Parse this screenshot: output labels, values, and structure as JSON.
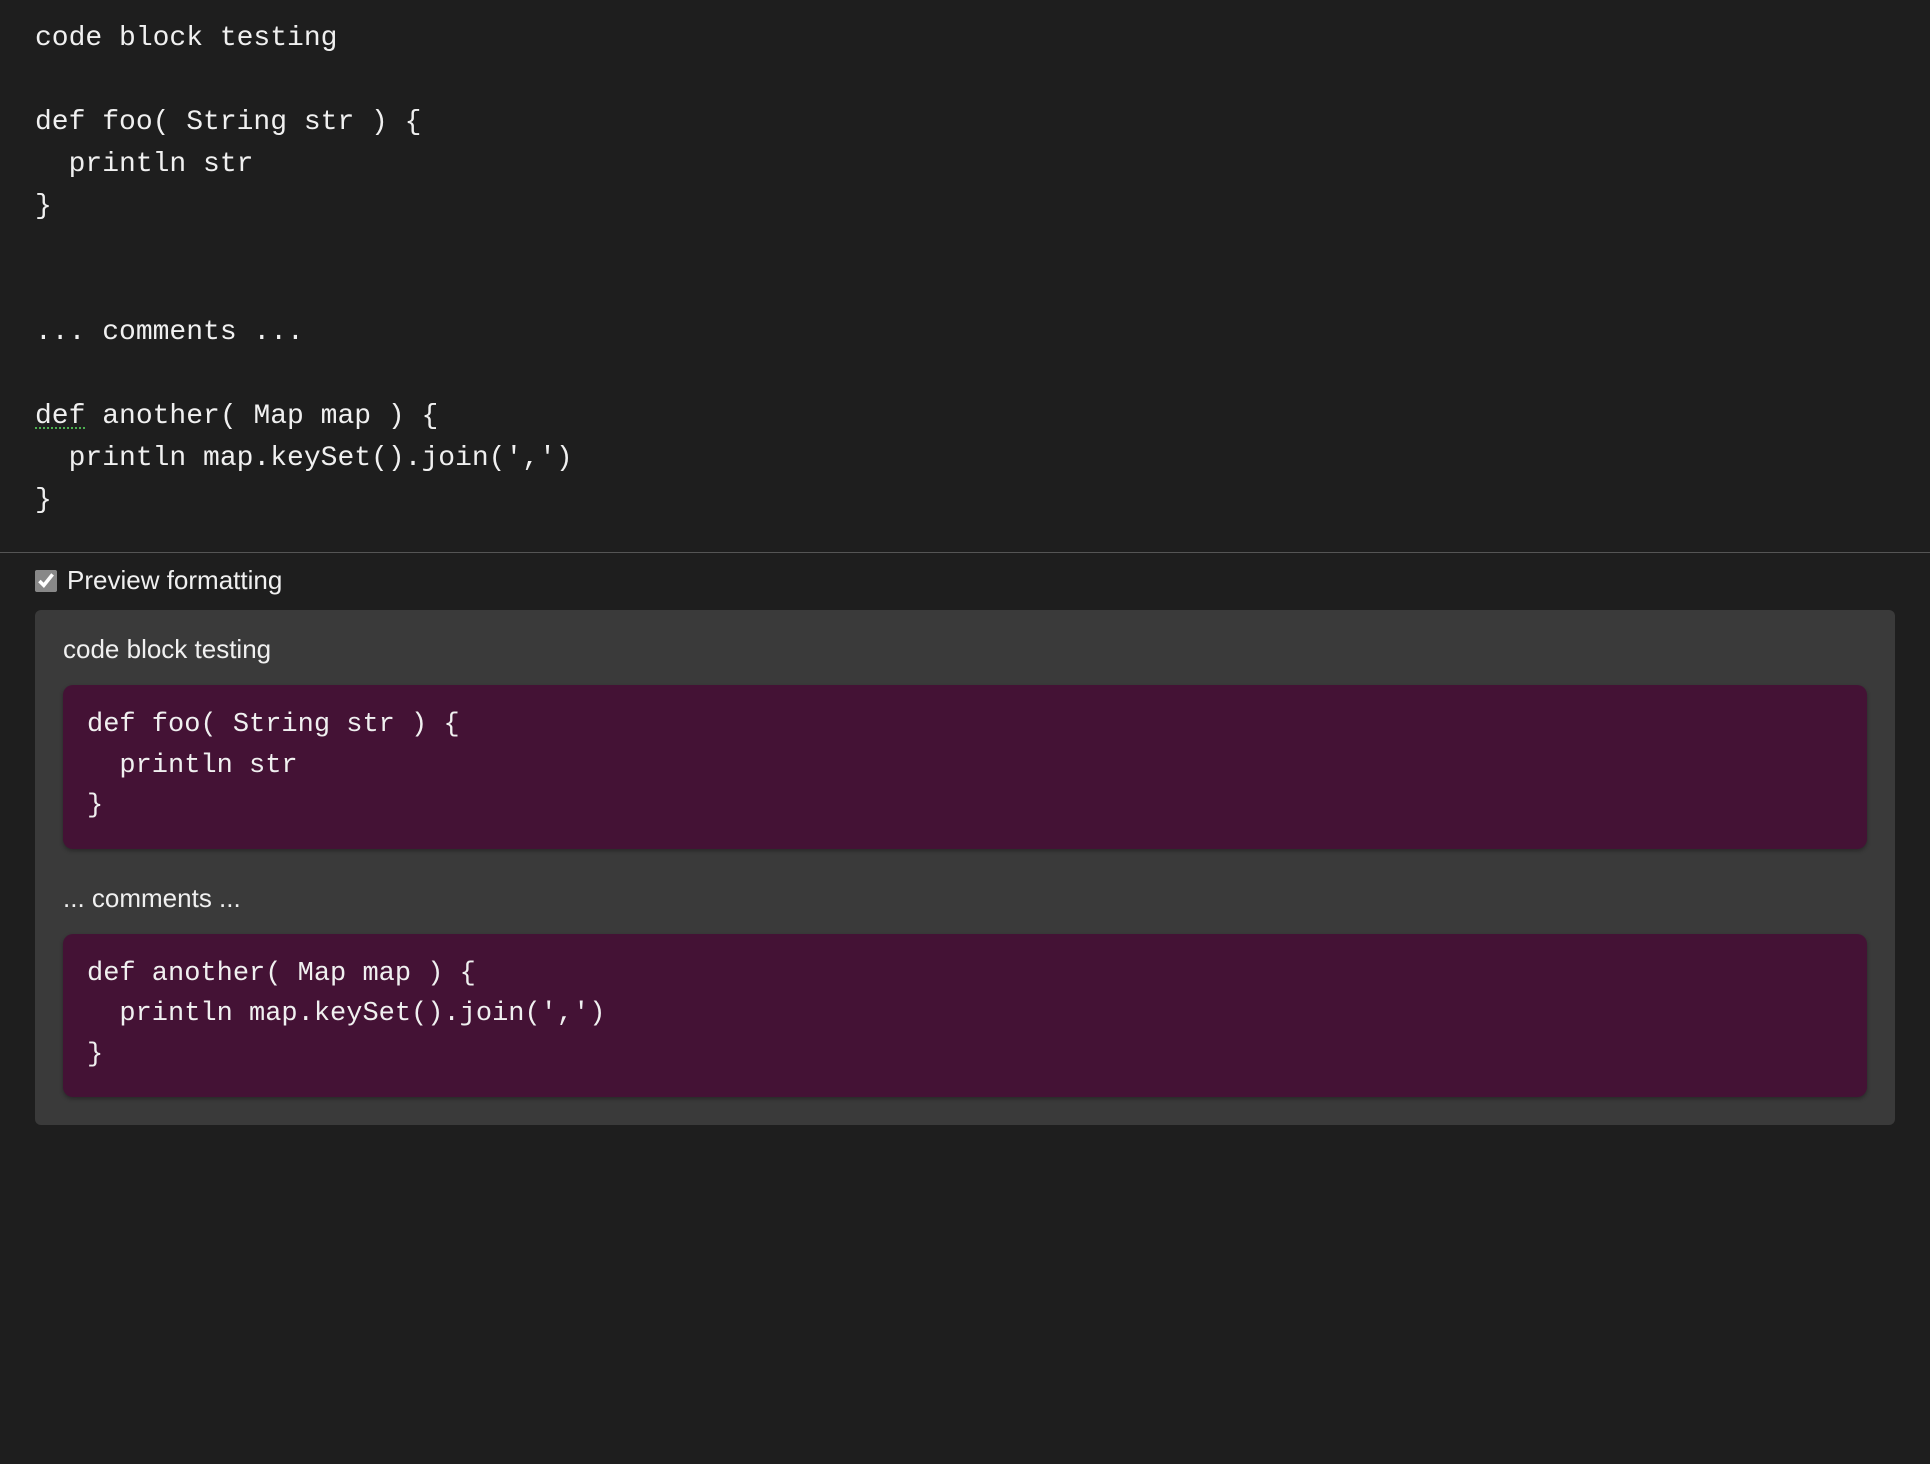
{
  "editor": {
    "line1": "code block testing",
    "line2": "",
    "line3": "def foo( String str ) {",
    "line4": "  println str",
    "line5": "}",
    "line6": "",
    "line7": "",
    "line8": "... comments ...",
    "line9": "",
    "line10_prefix": "def",
    "line10_rest": " another( Map map ) {",
    "line11": "  println map.keySet().join(',')",
    "line12": "}"
  },
  "preview": {
    "checkbox_label": "Preview formatting",
    "checkbox_checked": true,
    "text1": "code block testing",
    "code1": "def foo( String str ) {\n  println str\n}",
    "text2": "... comments ...",
    "code2": "def another( Map map ) {\n  println map.keySet().join(',')\n}"
  }
}
